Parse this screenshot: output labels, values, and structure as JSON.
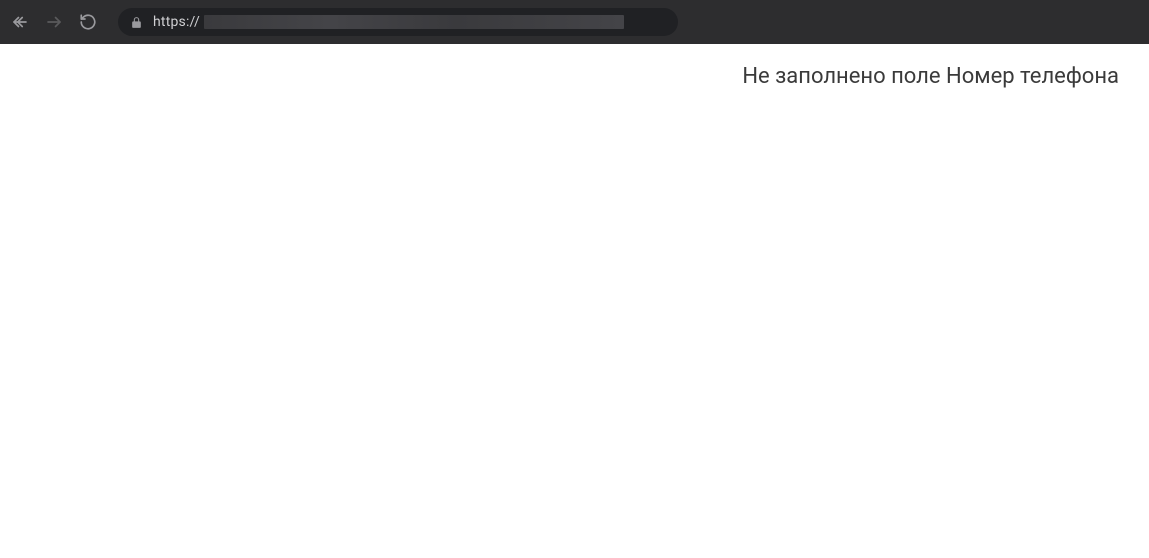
{
  "browser": {
    "url_prefix": "https://"
  },
  "page": {
    "error_message": "Не заполнено поле Номер телефона"
  }
}
